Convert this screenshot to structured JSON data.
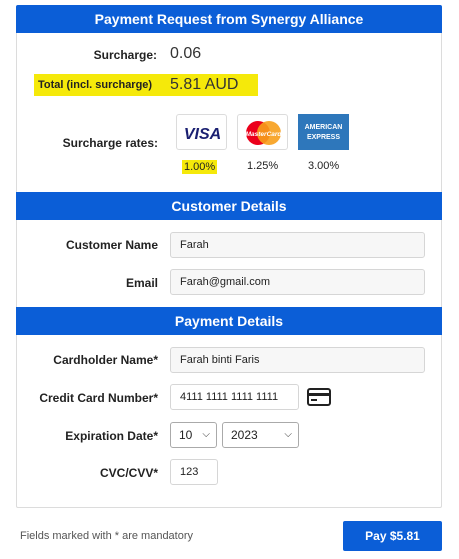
{
  "header": {
    "title": "Payment Request from Synergy Alliance"
  },
  "summary": {
    "surcharge_label": "Surcharge:",
    "surcharge_value": "0.06",
    "total_label": "Total (incl. surcharge)",
    "total_value": "5.81 AUD",
    "rates_label": "Surcharge rates:",
    "rates": [
      {
        "card": "VISA",
        "rate": "1.00%"
      },
      {
        "card": "MasterCard",
        "rate": "1.25%"
      },
      {
        "card": "AMERICAN EXPRESS",
        "rate": "3.00%"
      }
    ]
  },
  "customer": {
    "section_title": "Customer Details",
    "name_label": "Customer Name",
    "name_value": "Farah",
    "email_label": "Email",
    "email_value": "Farah@gmail.com"
  },
  "payment": {
    "section_title": "Payment Details",
    "cardholder_label": "Cardholder Name*",
    "cardholder_value": "Farah binti Faris",
    "cc_label": "Credit Card Number*",
    "cc_value": "4111 1111 1111 1111",
    "exp_label": "Expiration Date*",
    "exp_month": "10",
    "exp_year": "2023",
    "cvc_label": "CVC/CVV*",
    "cvc_value": "123"
  },
  "footer": {
    "note": "Fields marked with * are mandatory",
    "pay_label": "Pay $5.81"
  },
  "colors": {
    "accent": "#0b5ed7",
    "highlight": "#f5e90a"
  }
}
